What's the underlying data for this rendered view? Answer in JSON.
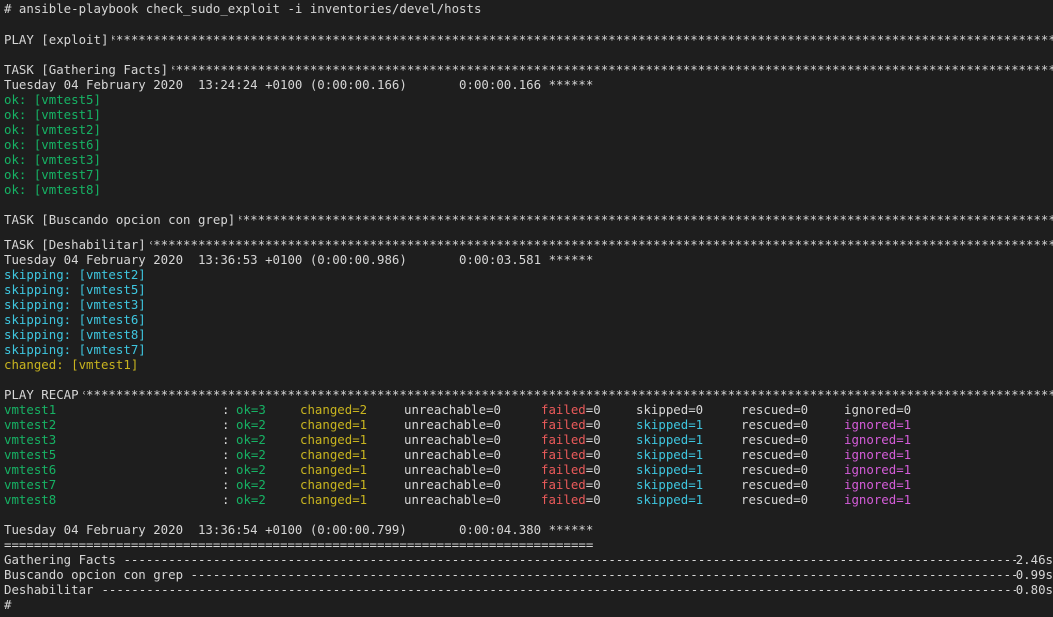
{
  "command": "# ansible-playbook check_sudo_exploit -i inventories/devel/hosts",
  "plays": {
    "play_header": "PLAY [exploit]",
    "task1_header": "TASK [Gathering Facts]",
    "task1_timing": "Tuesday 04 February 2020  13:24:24 +0100 (0:00:00.166)       0:00:00.166 ******",
    "task1_results": [
      "ok: [vmtest5]",
      "ok: [vmtest1]",
      "ok: [vmtest2]",
      "ok: [vmtest6]",
      "ok: [vmtest3]",
      "ok: [vmtest7]",
      "ok: [vmtest8]"
    ],
    "task2_header": "TASK [Buscando opcion con grep]",
    "task3_header": "TASK [Deshabilitar]",
    "task3_timing": "Tuesday 04 February 2020  13:36:53 +0100 (0:00:00.986)       0:00:03.581 ******",
    "task3_skipped": [
      "skipping: [vmtest2]",
      "skipping: [vmtest5]",
      "skipping: [vmtest3]",
      "skipping: [vmtest6]",
      "skipping: [vmtest8]",
      "skipping: [vmtest7]"
    ],
    "task3_changed": "changed: [vmtest1]",
    "recap_header": "PLAY RECAP"
  },
  "recap": [
    {
      "host": "vmtest1",
      "colon": ":",
      "ok": "ok=3",
      "changed": "changed=2",
      "unreachable": "unreachable=0",
      "failed": "failed=0",
      "skipped": "skipped=0",
      "rescued": "rescued=0",
      "ignored": "ignored=0"
    },
    {
      "host": "vmtest2",
      "colon": ":",
      "ok": "ok=2",
      "changed": "changed=1",
      "unreachable": "unreachable=0",
      "failed": "failed=0",
      "skipped": "skipped=1",
      "rescued": "rescued=0",
      "ignored": "ignored=1"
    },
    {
      "host": "vmtest3",
      "colon": ":",
      "ok": "ok=2",
      "changed": "changed=1",
      "unreachable": "unreachable=0",
      "failed": "failed=0",
      "skipped": "skipped=1",
      "rescued": "rescued=0",
      "ignored": "ignored=1"
    },
    {
      "host": "vmtest5",
      "colon": ":",
      "ok": "ok=2",
      "changed": "changed=1",
      "unreachable": "unreachable=0",
      "failed": "failed=0",
      "skipped": "skipped=1",
      "rescued": "rescued=0",
      "ignored": "ignored=1"
    },
    {
      "host": "vmtest6",
      "colon": ":",
      "ok": "ok=2",
      "changed": "changed=1",
      "unreachable": "unreachable=0",
      "failed": "failed=0",
      "skipped": "skipped=1",
      "rescued": "rescued=0",
      "ignored": "ignored=1"
    },
    {
      "host": "vmtest7",
      "colon": ":",
      "ok": "ok=2",
      "changed": "changed=1",
      "unreachable": "unreachable=0",
      "failed": "failed=0",
      "skipped": "skipped=1",
      "rescued": "rescued=0",
      "ignored": "ignored=1"
    },
    {
      "host": "vmtest8",
      "colon": ":",
      "ok": "ok=2",
      "changed": "changed=1",
      "unreachable": "unreachable=0",
      "failed": "failed=0",
      "skipped": "skipped=1",
      "rescued": "rescued=0",
      "ignored": "ignored=1"
    }
  ],
  "final_timing": "Tuesday 04 February 2020  13:36:54 +0100 (0:00:00.799)       0:00:04.380 ******",
  "separator": "===============================================================================",
  "profile": [
    {
      "name": "Gathering Facts",
      "time": "2.46s"
    },
    {
      "name": "Buscando opcion con grep",
      "time": "0.99s"
    },
    {
      "name": "Deshabilitar",
      "time": "0.80s"
    }
  ],
  "prompt": "#",
  "colors": {
    "background": "#1e1e1e",
    "text": "#d6d6d6",
    "ok": "#16b264",
    "skipping": "#3ec6df",
    "changed": "#c8b41f",
    "failed": "#ea5a5a",
    "ignored": "#d35cd8"
  }
}
